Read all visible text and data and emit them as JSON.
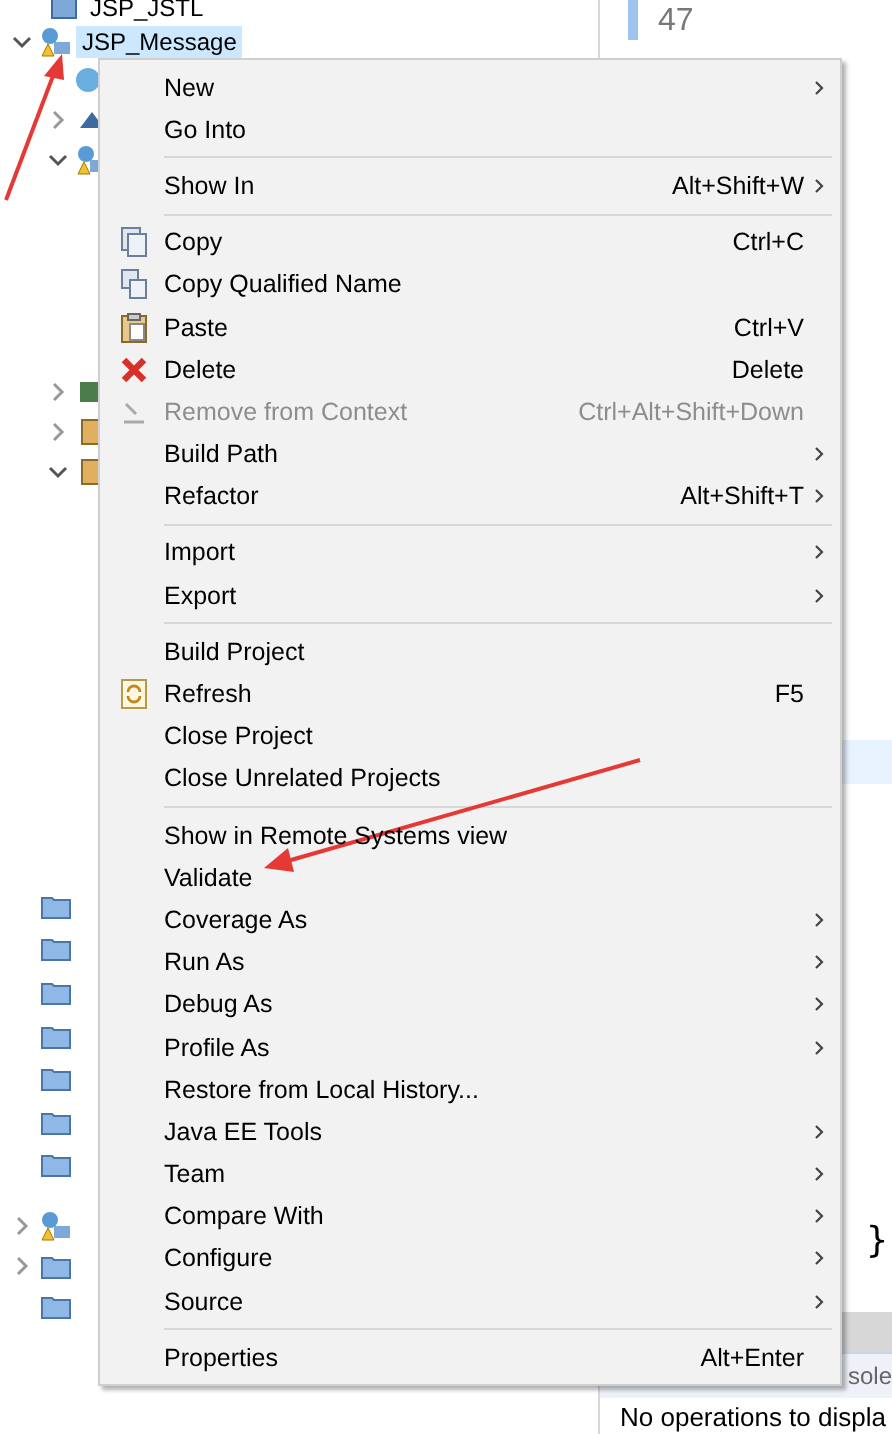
{
  "project_tree": {
    "items": [
      {
        "label": "JSP_JSTL",
        "selected": false
      },
      {
        "label": "JSP_Message",
        "selected": true
      }
    ]
  },
  "editor": {
    "line_number": "47",
    "brace": "}",
    "console_tab": "sole",
    "console_message": "No operations to displa"
  },
  "context_menu": [
    {
      "kind": "item",
      "label": "New",
      "submenu": true,
      "disabled": false
    },
    {
      "kind": "item",
      "label": "Go Into",
      "submenu": false,
      "disabled": false
    },
    {
      "kind": "separator"
    },
    {
      "kind": "item",
      "label": "Show In",
      "shortcut": "Alt+Shift+W",
      "submenu": true,
      "disabled": false
    },
    {
      "kind": "separator"
    },
    {
      "kind": "item",
      "label": "Copy",
      "shortcut": "Ctrl+C",
      "submenu": false,
      "disabled": false
    },
    {
      "kind": "item",
      "label": "Copy Qualified Name",
      "submenu": false,
      "disabled": false
    },
    {
      "kind": "item",
      "label": "Paste",
      "shortcut": "Ctrl+V",
      "submenu": false,
      "disabled": false
    },
    {
      "kind": "item",
      "label": "Delete",
      "shortcut": "Delete",
      "submenu": false,
      "disabled": false
    },
    {
      "kind": "item",
      "label": "Remove from Context",
      "shortcut": "Ctrl+Alt+Shift+Down",
      "submenu": false,
      "disabled": true
    },
    {
      "kind": "item",
      "label": "Build Path",
      "submenu": true,
      "disabled": false
    },
    {
      "kind": "item",
      "label": "Refactor",
      "shortcut": "Alt+Shift+T",
      "submenu": true,
      "disabled": false
    },
    {
      "kind": "separator"
    },
    {
      "kind": "item",
      "label": "Import",
      "submenu": true,
      "disabled": false
    },
    {
      "kind": "item",
      "label": "Export",
      "submenu": true,
      "disabled": false
    },
    {
      "kind": "separator"
    },
    {
      "kind": "item",
      "label": "Build Project",
      "submenu": false,
      "disabled": false
    },
    {
      "kind": "item",
      "label": "Refresh",
      "shortcut": "F5",
      "submenu": false,
      "disabled": false
    },
    {
      "kind": "item",
      "label": "Close Project",
      "submenu": false,
      "disabled": false
    },
    {
      "kind": "item",
      "label": "Close Unrelated Projects",
      "submenu": false,
      "disabled": false
    },
    {
      "kind": "separator"
    },
    {
      "kind": "item",
      "label": "Show in Remote Systems view",
      "submenu": false,
      "disabled": false
    },
    {
      "kind": "item",
      "label": "Validate",
      "submenu": false,
      "disabled": false
    },
    {
      "kind": "item",
      "label": "Coverage As",
      "submenu": true,
      "disabled": false
    },
    {
      "kind": "item",
      "label": "Run As",
      "submenu": true,
      "disabled": false
    },
    {
      "kind": "item",
      "label": "Debug As",
      "submenu": true,
      "disabled": false
    },
    {
      "kind": "item",
      "label": "Profile As",
      "submenu": true,
      "disabled": false
    },
    {
      "kind": "item",
      "label": "Restore from Local History...",
      "submenu": false,
      "disabled": false
    },
    {
      "kind": "item",
      "label": "Java EE Tools",
      "submenu": true,
      "disabled": false
    },
    {
      "kind": "item",
      "label": "Team",
      "submenu": true,
      "disabled": false
    },
    {
      "kind": "item",
      "label": "Compare With",
      "submenu": true,
      "disabled": false
    },
    {
      "kind": "item",
      "label": "Configure",
      "submenu": true,
      "disabled": false
    },
    {
      "kind": "item",
      "label": "Source",
      "submenu": true,
      "disabled": false
    },
    {
      "kind": "separator"
    },
    {
      "kind": "item",
      "label": "Properties",
      "shortcut": "Alt+Enter",
      "submenu": false,
      "disabled": false
    }
  ]
}
